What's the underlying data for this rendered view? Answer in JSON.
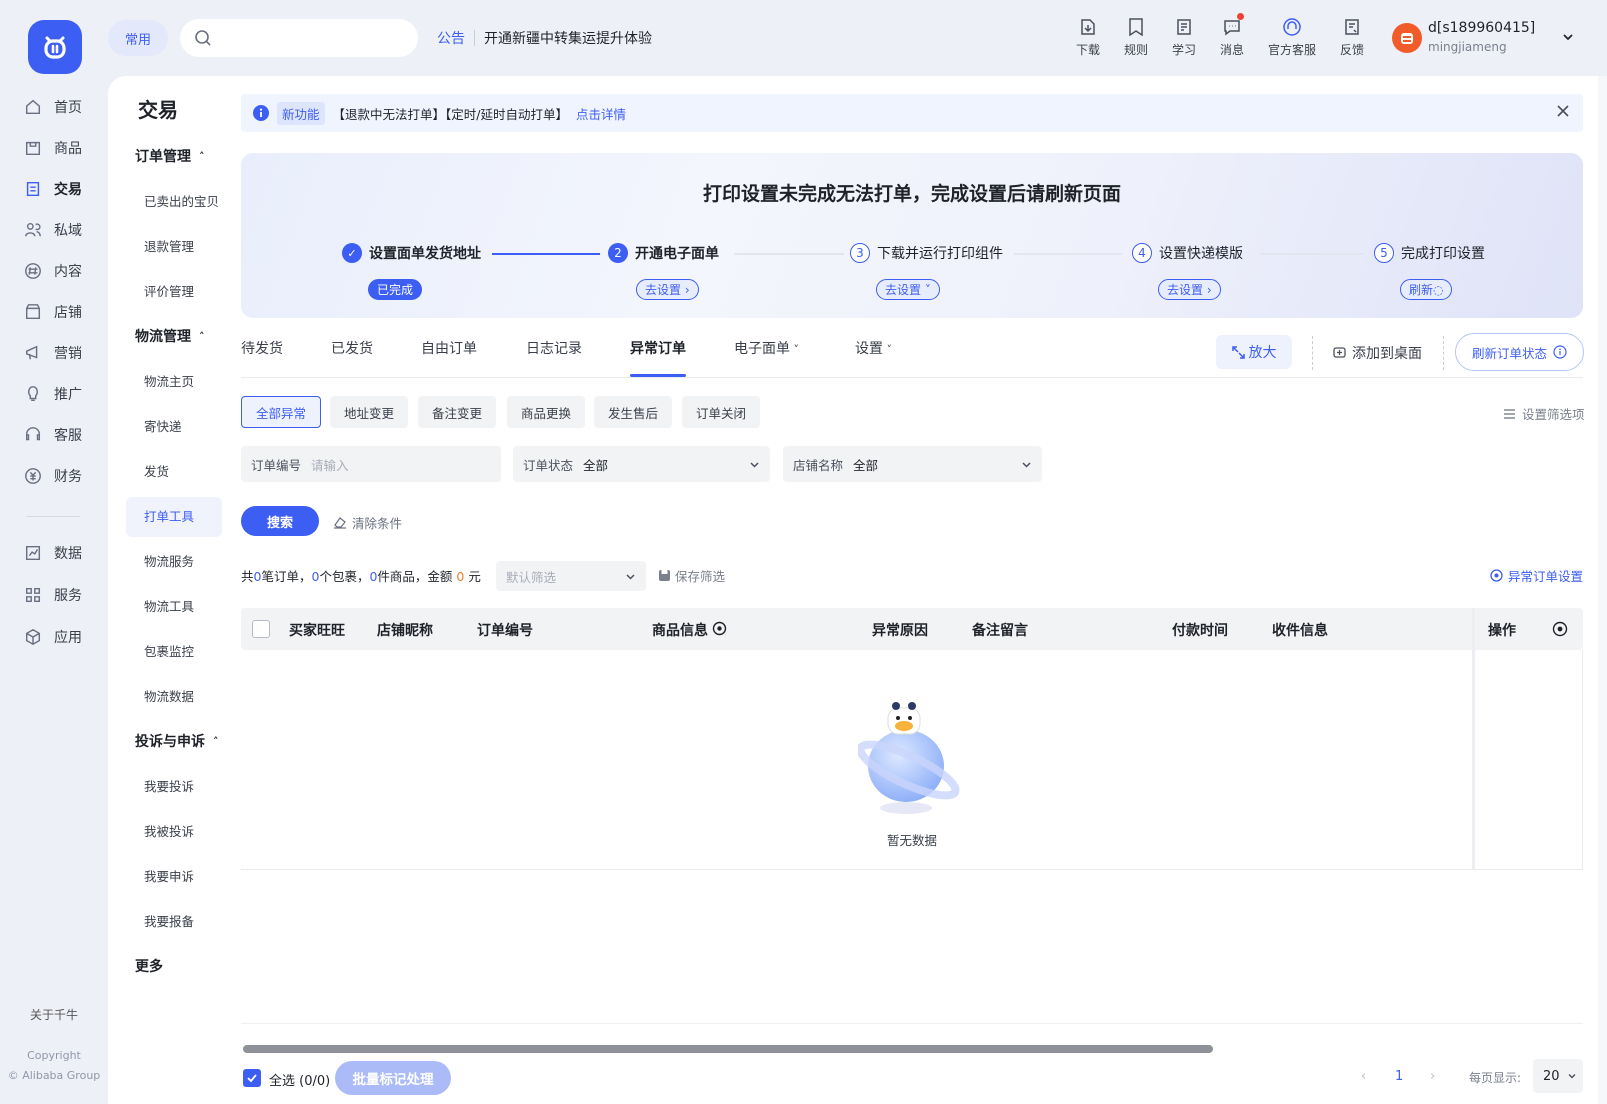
{
  "topbar": {
    "common_label": "常用",
    "search_placeholder": "",
    "announce_label": "公告",
    "announce_text": "开通新疆中转集运提升体验",
    "icons": [
      {
        "label": "下载",
        "icon": "download-icon"
      },
      {
        "label": "规则",
        "icon": "rules-icon"
      },
      {
        "label": "学习",
        "icon": "learn-icon"
      },
      {
        "label": "消息",
        "icon": "message-icon"
      },
      {
        "label": "官方客服",
        "icon": "service-icon"
      },
      {
        "label": "反馈",
        "icon": "feedback-icon"
      }
    ],
    "user_name": "d[s189960415]",
    "user_sub": "mingjiameng"
  },
  "nav": {
    "items": [
      {
        "label": "首页",
        "icon": "home-icon"
      },
      {
        "label": "商品",
        "icon": "goods-icon"
      },
      {
        "label": "交易",
        "icon": "trade-icon"
      },
      {
        "label": "私域",
        "icon": "private-icon"
      },
      {
        "label": "内容",
        "icon": "content-icon"
      },
      {
        "label": "店铺",
        "icon": "shop-icon"
      },
      {
        "label": "营销",
        "icon": "marketing-icon"
      },
      {
        "label": "推广",
        "icon": "promote-icon"
      },
      {
        "label": "客服",
        "icon": "support-icon"
      },
      {
        "label": "财务",
        "icon": "finance-icon"
      }
    ],
    "items2": [
      {
        "label": "数据",
        "icon": "data-icon"
      },
      {
        "label": "服务",
        "icon": "service-grid-icon"
      },
      {
        "label": "应用",
        "icon": "apps-icon"
      }
    ],
    "active": "交易",
    "about": "关于千牛",
    "copyright_line1": "Copyright",
    "copyright_line2": "© Alibaba Group"
  },
  "subnav": {
    "title": "交易",
    "groups": [
      {
        "label": "订单管理",
        "items": [
          "已卖出的宝贝",
          "退款管理",
          "评价管理"
        ]
      },
      {
        "label": "物流管理",
        "items": [
          "物流主页",
          "寄快递",
          "发货",
          "打单工具",
          "物流服务",
          "物流工具",
          "包裹监控",
          "物流数据"
        ]
      },
      {
        "label": "投诉与申诉",
        "items": [
          "我要投诉",
          "我被投诉",
          "我要申诉",
          "我要报备"
        ]
      }
    ],
    "more": "更多",
    "active": "打单工具"
  },
  "notice": {
    "tag": "新功能",
    "text": "【退款中无法打单】【定时/延时自动打单】",
    "link": "点击详情"
  },
  "setup": {
    "title": "打印设置未完成无法打单，完成设置后请刷新页面",
    "steps": [
      {
        "num": "✓",
        "label": "设置面单发货地址",
        "button": "已完成",
        "state": "done"
      },
      {
        "num": "2",
        "label": "开通电子面单",
        "button": "去设置 ›",
        "state": "current"
      },
      {
        "num": "3",
        "label": "下载并运行打印组件",
        "button": "去设置 ˅",
        "state": "todo"
      },
      {
        "num": "4",
        "label": "设置快递模版",
        "button": "去设置 ›",
        "state": "todo"
      },
      {
        "num": "5",
        "label": "完成打印设置",
        "button": "刷新◌",
        "state": "todo"
      }
    ]
  },
  "tabs": [
    {
      "label": "待发货"
    },
    {
      "label": "已发货"
    },
    {
      "label": "自由订单"
    },
    {
      "label": "日志记录"
    },
    {
      "label": "异常订单"
    },
    {
      "label": "电子面单"
    },
    {
      "label": "设置"
    }
  ],
  "active_tab": "异常订单",
  "toolbar": {
    "zoom": "放大",
    "add_desktop": "添加到桌面",
    "refresh_status": "刷新订单状态"
  },
  "chips": [
    "全部异常",
    "地址变更",
    "备注变更",
    "商品更换",
    "发生售后",
    "订单关闭"
  ],
  "filter_options": "设置筛选项",
  "fields": {
    "order_no_label": "订单编号",
    "order_no_placeholder": "请输入",
    "order_status_label": "订单状态",
    "order_status_value": "全部",
    "shop_label": "店铺名称",
    "shop_value": "全部"
  },
  "search_button": "搜索",
  "clear_button": "清除条件",
  "summary": {
    "p1": "共",
    "orders": "0",
    "p2": "笔订单，",
    "packages": "0",
    "p3": "个包裹，",
    "goods": "0",
    "p4": "件商品，金额",
    "amount": "0",
    "p5": "元"
  },
  "default_filter": "默认筛选",
  "save_filter": "保存筛选",
  "abnormal_setting": "异常订单设置",
  "table": {
    "columns": [
      "买家旺旺",
      "店铺昵称",
      "订单编号",
      "商品信息",
      "异常原因",
      "备注留言",
      "付款时间",
      "收件信息",
      "操作"
    ],
    "empty": "暂无数据"
  },
  "footer": {
    "select_all": "全选 (0/0)",
    "batch": "批量标记处理",
    "page": "1",
    "page_size_label": "每页显示:",
    "page_size": "20"
  },
  "colors": {
    "accent": "#3d5ef2",
    "amount": "#f5802a",
    "alert_dot": "#f04134"
  }
}
